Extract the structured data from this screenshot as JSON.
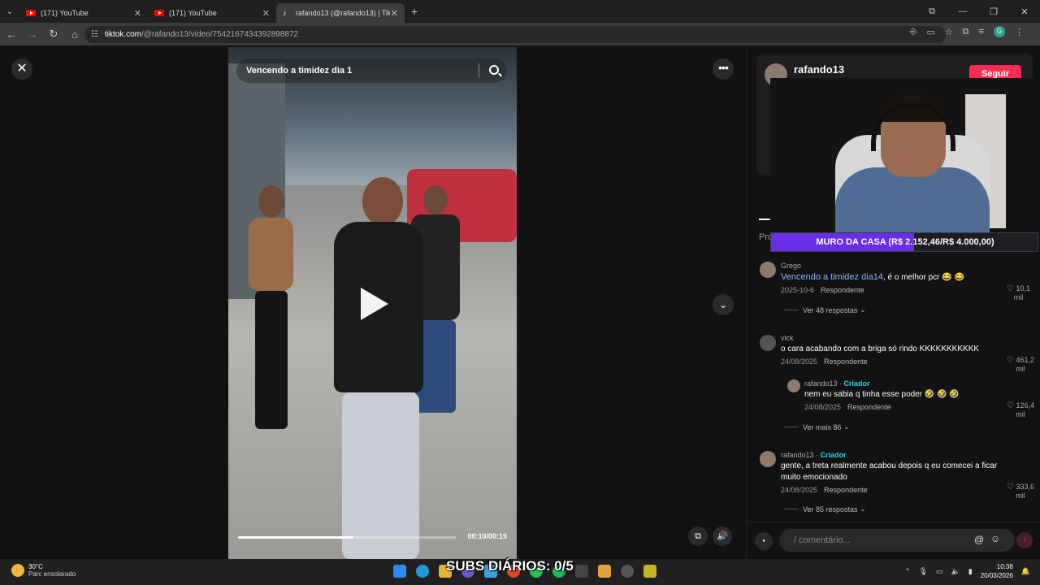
{
  "browser": {
    "tabs": [
      {
        "label": "(171) YouTube",
        "icon": "youtube-icon"
      },
      {
        "label": "(171) YouTube",
        "icon": "youtube-icon"
      },
      {
        "label": "rafando13 (@rafando13) | TikTo",
        "icon": "tiktok-icon"
      }
    ],
    "url_host": "tiktok.com",
    "url_path": "/@rafando13/video/7542167434392898872",
    "profile_initial": "G"
  },
  "video": {
    "search_text": "Vencendo a timidez dia 1",
    "time": "00:10/00:19",
    "progress": 0.53
  },
  "sidebar": {
    "username": "rafando13",
    "follow_label": "Seguir",
    "tab_label": "Pro"
  },
  "overlay": {
    "goal_text": "MURO DA CASA (R$ 2.152,46/R$ 4.000,00)",
    "goal_fraction": 0.538,
    "subs_text": "SUBS DIÁRIOS: 0/5"
  },
  "comments": [
    {
      "author": "Grego",
      "text_link": "Vencendo a timidez dia14",
      "text": ", é o melhor pcr 😂 😂",
      "date": "2025-10-6",
      "reply": "Respondente",
      "likes": "10,1",
      "likes_unit": "mil",
      "replies_label": "Ver 48 respostas"
    },
    {
      "author": "vick",
      "text": "o cara acabando com a briga só rindo KKKKKKKKKKK",
      "date": "24/08/2025",
      "reply": "Respondente",
      "likes": "461,2",
      "likes_unit": "mil"
    },
    {
      "author": "rafando13",
      "creator": "Criador",
      "text": "nem eu sabia q tinha esse poder 🤣 🤣 🤣",
      "date": "24/08/2025",
      "reply": "Respondente",
      "likes": "126,4",
      "likes_unit": "mil",
      "replies_label": "Ver mais 86"
    },
    {
      "author": "rafando13",
      "creator": "Criador",
      "text": "gente, a treta realmente acabou depois q eu comecei a ficar muito emocionado",
      "date": "24/08/2025",
      "reply": "Respondente",
      "likes": "333,6",
      "likes_unit": "mil",
      "replies_label": "Ver 85 respostas"
    }
  ],
  "comment_input": {
    "placeholder": "/  comentário..."
  },
  "taskbar": {
    "temp": "30°C",
    "weather": "Parc ensolarado",
    "time": "10:38",
    "date": "20/03/2026"
  }
}
